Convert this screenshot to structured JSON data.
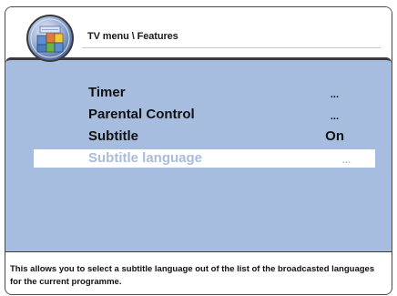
{
  "header": {
    "breadcrumb": "TV menu \\ Features",
    "icon": "features-icon"
  },
  "menu": {
    "items": [
      {
        "label": "Timer",
        "value": "...",
        "selected": false
      },
      {
        "label": "Parental Control",
        "value": "...",
        "selected": false
      },
      {
        "label": "Subtitle",
        "value": "On",
        "selected": false
      },
      {
        "label": "Subtitle language",
        "value": "...",
        "selected": true
      }
    ]
  },
  "help": {
    "text": "This allows you to select a subtitle language out of the list of the broadcasted languages for the current programme."
  },
  "colors": {
    "panel": "#a6bde0",
    "selected_row": "#ffffff",
    "selected_text": "#a8bcdc"
  }
}
